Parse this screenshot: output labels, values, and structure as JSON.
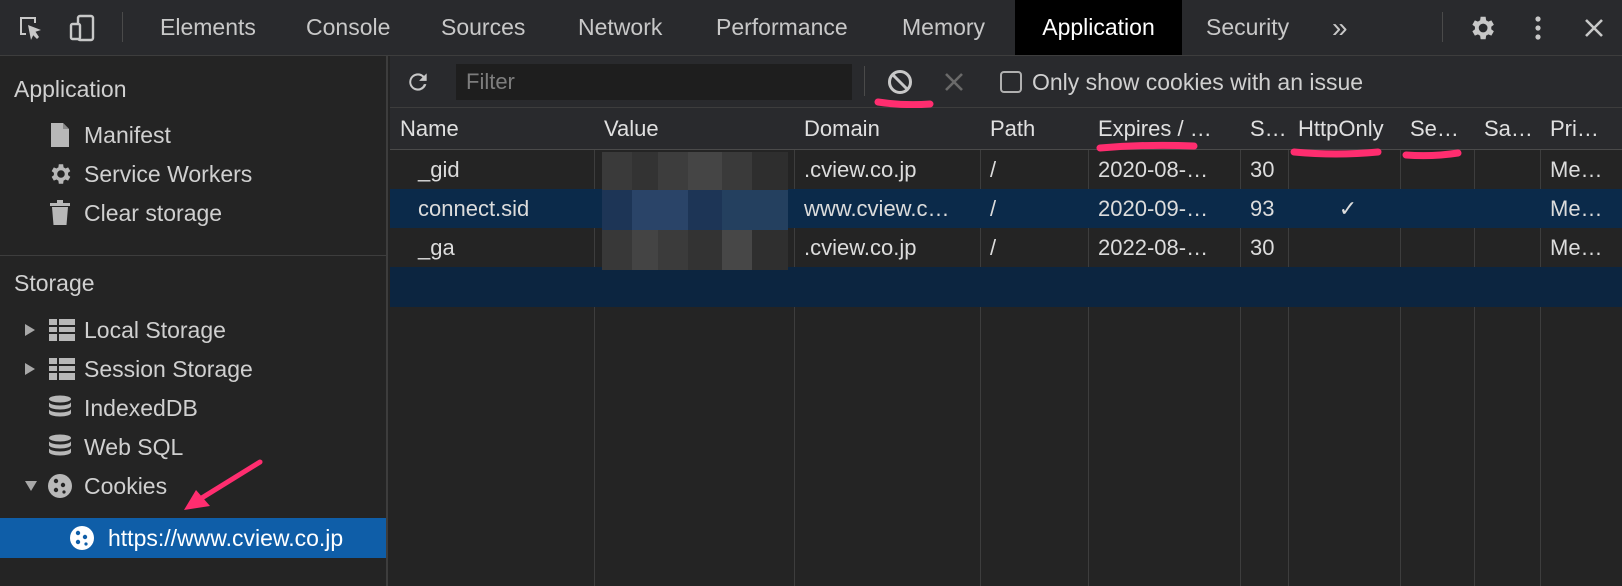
{
  "toolbar": {
    "tabs": [
      {
        "label": "Elements"
      },
      {
        "label": "Console"
      },
      {
        "label": "Sources"
      },
      {
        "label": "Network"
      },
      {
        "label": "Performance"
      },
      {
        "label": "Memory"
      },
      {
        "label": "Application",
        "active": true
      },
      {
        "label": "Security"
      }
    ],
    "overflow_label": "»"
  },
  "sidebar": {
    "application_section": {
      "title": "Application",
      "items": [
        {
          "label": "Manifest",
          "icon": "manifest-icon"
        },
        {
          "label": "Service Workers",
          "icon": "gear-icon"
        },
        {
          "label": "Clear storage",
          "icon": "trash-icon"
        }
      ]
    },
    "storage_section": {
      "title": "Storage",
      "items": [
        {
          "label": "Local Storage",
          "icon": "grid-icon",
          "expandable": true,
          "expanded": false
        },
        {
          "label": "Session Storage",
          "icon": "grid-icon",
          "expandable": true,
          "expanded": false
        },
        {
          "label": "IndexedDB",
          "icon": "database-icon"
        },
        {
          "label": "Web SQL",
          "icon": "database-icon"
        },
        {
          "label": "Cookies",
          "icon": "cookie-icon",
          "expandable": true,
          "expanded": true
        },
        {
          "label": "https://www.cview.co.jp",
          "icon": "cookie-icon",
          "selected": true
        }
      ]
    }
  },
  "cookies_toolbar": {
    "filter_placeholder": "Filter",
    "issue_filter_label": "Only show cookies with an issue",
    "issue_filter_checked": false
  },
  "table": {
    "columns": [
      "Name",
      "Value",
      "Domain",
      "Path",
      "Expires / …",
      "S…",
      "HttpOnly",
      "Se…",
      "Sa…",
      "Pri…"
    ],
    "rows": [
      {
        "name": "_gid",
        "domain": ".cview.co.jp",
        "path": "/",
        "expires": "2020-08-…",
        "size": "30",
        "httponly": "",
        "priority": "Me…",
        "selected": false
      },
      {
        "name": "connect.sid",
        "domain": "www.cview.c…",
        "path": "/",
        "expires": "2020-09-…",
        "size": "93",
        "httponly": "✓",
        "priority": "Me…",
        "selected": true
      },
      {
        "name": "_ga",
        "domain": ".cview.co.jp",
        "path": "/",
        "expires": "2022-08-…",
        "size": "30",
        "httponly": "",
        "priority": "Me…",
        "selected": false
      }
    ]
  },
  "colors": {
    "accent_selected": "#0f5ea8",
    "selected_row": "#0b2a4a",
    "annotation": "#ff2d6f"
  }
}
